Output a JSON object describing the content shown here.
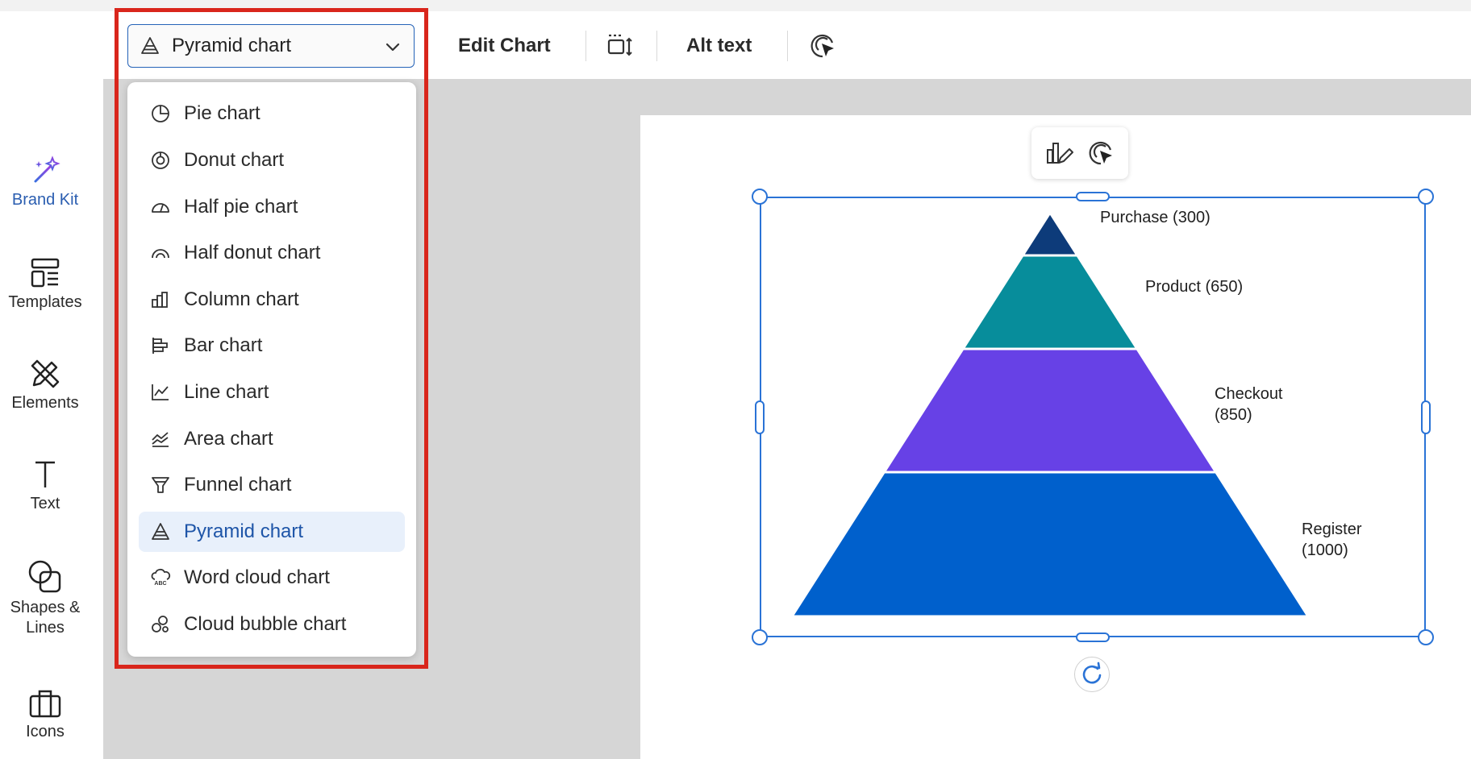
{
  "sidebar": {
    "items": [
      {
        "label": "Brand Kit",
        "icon": "magic-wand-icon",
        "active": true
      },
      {
        "label": "Templates",
        "icon": "templates-icon"
      },
      {
        "label": "Elements",
        "icon": "elements-icon"
      },
      {
        "label": "Text",
        "icon": "text-icon"
      },
      {
        "label": "Shapes &",
        "label2": "Lines",
        "icon": "shapes-icon"
      },
      {
        "label": "Icons",
        "icon": "briefcase-icon"
      }
    ]
  },
  "toolbar": {
    "chart_type_selected": "Pyramid chart",
    "edit_chart": "Edit Chart",
    "alt_text": "Alt text"
  },
  "menu": {
    "items": [
      {
        "label": "Pie chart",
        "icon": "pie-chart-icon"
      },
      {
        "label": "Donut chart",
        "icon": "donut-chart-icon"
      },
      {
        "label": "Half pie chart",
        "icon": "half-pie-chart-icon"
      },
      {
        "label": "Half donut chart",
        "icon": "half-donut-chart-icon"
      },
      {
        "label": "Column chart",
        "icon": "column-chart-icon"
      },
      {
        "label": "Bar chart",
        "icon": "bar-chart-icon"
      },
      {
        "label": "Line chart",
        "icon": "line-chart-icon"
      },
      {
        "label": "Area chart",
        "icon": "area-chart-icon"
      },
      {
        "label": "Funnel chart",
        "icon": "funnel-chart-icon"
      },
      {
        "label": "Pyramid chart",
        "icon": "pyramid-chart-icon",
        "selected": true
      },
      {
        "label": "Word cloud chart",
        "icon": "word-cloud-chart-icon"
      },
      {
        "label": "Cloud bubble chart",
        "icon": "cloud-bubble-chart-icon"
      }
    ]
  },
  "colors": {
    "accent": "#2a73d6",
    "highlight": "#d9261c"
  },
  "chart_data": {
    "type": "pyramid",
    "categories": [
      "Purchase",
      "Product",
      "Checkout",
      "Register"
    ],
    "values": [
      300,
      650,
      850,
      1000
    ],
    "labels": [
      [
        "Purchase (300)"
      ],
      [
        "Product (650)"
      ],
      [
        "Checkout",
        "(850)"
      ],
      [
        "Register",
        "(1000)"
      ]
    ],
    "colors": [
      "#0d3b7a",
      "#078d9b",
      "#6741e6",
      "#0060cc"
    ],
    "title": "",
    "legend": "none"
  }
}
